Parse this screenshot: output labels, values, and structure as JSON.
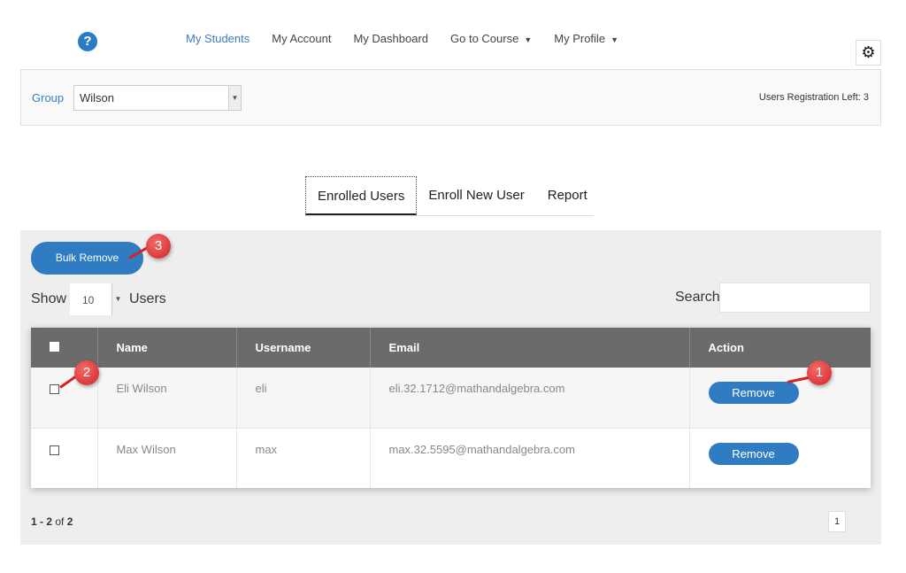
{
  "nav": {
    "help_icon": "question-circle",
    "items": [
      {
        "label": "My Students",
        "active": true,
        "dropdown": false
      },
      {
        "label": "My Account",
        "active": false,
        "dropdown": false
      },
      {
        "label": "My Dashboard",
        "active": false,
        "dropdown": false
      },
      {
        "label": "Go to Course",
        "active": false,
        "dropdown": true
      },
      {
        "label": "My Profile",
        "active": false,
        "dropdown": true
      }
    ],
    "settings_icon": "gear"
  },
  "group": {
    "label": "Group",
    "selected": "Wilson",
    "registration_left": "Users Registration Left: 3"
  },
  "tabs": [
    {
      "label": "Enrolled Users",
      "active": true
    },
    {
      "label": "Enroll New User",
      "active": false
    },
    {
      "label": "Report",
      "active": false
    }
  ],
  "toolbar": {
    "bulk_remove_label": "Bulk Remove",
    "show_label": "Show",
    "show_value": "10",
    "users_label": "Users",
    "search_label": "Search",
    "search_value": ""
  },
  "table": {
    "columns": [
      "",
      "Name",
      "Username",
      "Email",
      "Action"
    ],
    "rows": [
      {
        "name": "Eli Wilson",
        "username": "eli",
        "email": "eli.32.1712@mathandalgebra.com",
        "action": "Remove",
        "checked": false
      },
      {
        "name": "Max Wilson",
        "username": "max",
        "email": "max.32.5595@mathandalgebra.com",
        "action": "Remove",
        "checked": false
      }
    ]
  },
  "pagination": {
    "range": "1 - 2",
    "of_label": "of",
    "total": "2",
    "current_page": "1"
  },
  "callouts": [
    "1",
    "2",
    "3"
  ],
  "colors": {
    "accent": "#2f7cc3",
    "link": "#3a7ec0",
    "header": "#6b6b6b",
    "callout": "#d42323"
  }
}
